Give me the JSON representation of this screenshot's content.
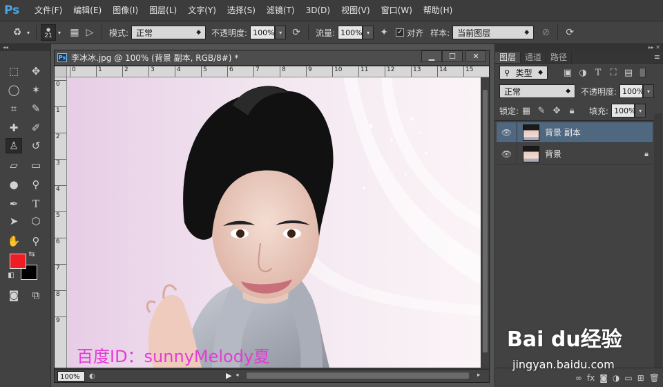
{
  "app": {
    "logo": "Ps"
  },
  "menu": [
    "文件(F)",
    "编辑(E)",
    "图像(I)",
    "图层(L)",
    "文字(Y)",
    "选择(S)",
    "滤镜(T)",
    "3D(D)",
    "视图(V)",
    "窗口(W)",
    "帮助(H)"
  ],
  "options": {
    "brush_size": "21",
    "mode_label": "模式:",
    "mode_value": "正常",
    "opacity_label": "不透明度:",
    "opacity_value": "100%",
    "flow_label": "流量:",
    "flow_value": "100%",
    "aligned_label": "对齐",
    "aligned_checked": true,
    "sample_label": "样本:",
    "sample_value": "当前图层"
  },
  "document": {
    "title": "李冰冰.jpg @ 100% (背景 副本, RGB/8#) *",
    "ps_badge": "Ps",
    "zoom": "100%",
    "watermark": "百度ID：sunnyMelody夏",
    "ruler_h": [
      "0",
      "1",
      "2",
      "3",
      "4",
      "5",
      "6",
      "7",
      "8",
      "9",
      "10",
      "11",
      "12",
      "13",
      "14",
      "15"
    ],
    "ruler_v": [
      "0",
      "1",
      "2",
      "3",
      "4",
      "5",
      "6",
      "7",
      "8",
      "9"
    ]
  },
  "layers_panel": {
    "tabs": [
      "图层",
      "通道",
      "路径"
    ],
    "active_tab": 0,
    "filter_kind": "类型",
    "blend_mode": "正常",
    "opacity_label": "不透明度:",
    "opacity_value": "100%",
    "lock_label": "锁定:",
    "fill_label": "填充:",
    "fill_value": "100%",
    "layers": [
      {
        "name": "背景 副本",
        "selected": true,
        "locked": false
      },
      {
        "name": "背景",
        "selected": false,
        "locked": true
      }
    ]
  },
  "overlay": {
    "brand": "Bai du经验",
    "url": "jingyan.baidu.com"
  },
  "colors": {
    "foreground": "#ee1c24",
    "background": "#000000",
    "selection": "#506780",
    "watermark": "#e43bd7"
  }
}
